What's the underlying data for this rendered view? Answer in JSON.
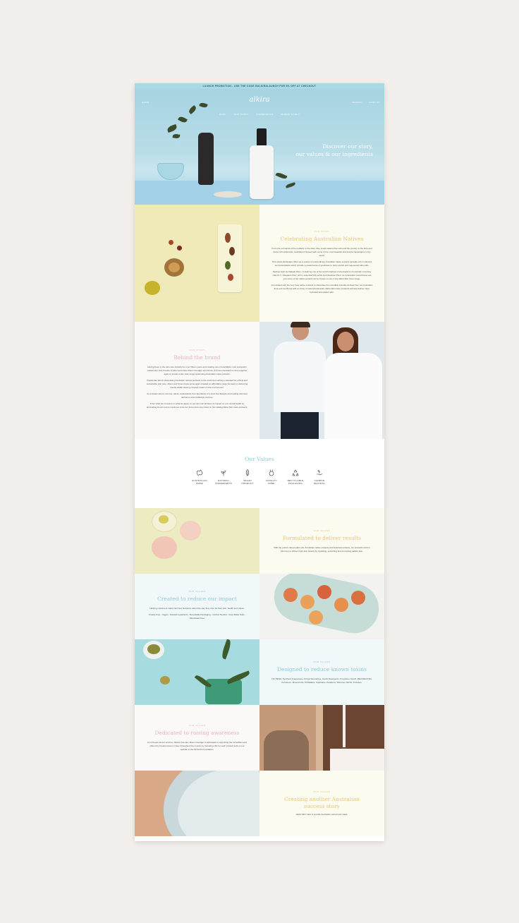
{
  "promo": "LAUNCH PROMOTION - USE THE CODE RALKIRALAUNCH FOR 5% OFF AT CHECKOUT",
  "nav": {
    "left": "HOME",
    "logo": "alkira",
    "right": [
      "SEARCH",
      "CART (0)"
    ],
    "menu": [
      "SHOP",
      "OUR STORY",
      "INGREDIENTS",
      "WHERE TO BUY"
    ]
  },
  "hero": {
    "title_line1": "Discover our story,",
    "title_line2": "our values & our ingredients"
  },
  "natives": {
    "eyebrow": "OUR STORY",
    "title": "Celebrating Australian Natives",
    "paragraphs": [
      "From the red sands of the outback to the clear, blue ocean waters that surround the country to the flora and fauna rich rainforests, Australia is blessed with some of the most beautiful and diverse landscapes in the world.",
      "This varied landscape offers up a variety of extraordinary Australian native extracts typically rich in vitamins and antioxidants which provide a powerhouse of goodness to help nourish and regenerate skin cells.",
      "Natives such as Kakadu Plum, containing one of the world's highest concentrations of naturally occurring vitamin C, Kangaroo Paw, rich in essential fatty acids and Davidson Plum, an antioxidant powerhouse are just some of the native extracts we've chosen to use in the Alkira Skin Care range.",
      "Formulated with the very best native extracts to showcase the incredible benefits derived from our Australian flora and combined with an array of natural botanicals, Alkira Skin Care products will help deliver clear, hydrated and radiant skin."
    ]
  },
  "brand": {
    "eyebrow": "OUR STORY",
    "title": "Behind the brand",
    "paragraphs": [
      "Having been in the skin care industry for over fifteen years and creating one of Australia's most successful natural skin care brands, brother and sister Alison Goodger and Simon O'Connor decided to come together again to create a skin care range celebrating Australian native extracts.",
      "Passionate about showcasing Australian natural products to the world and setting a standard for ethical and sustainable skin care, Alison and Simon have come again created an affordable range focused on delivering results whilst causing minimal impact on the environment.",
      "As a breast cancer survivor, Alison understands the importance of a toxic free lifestyle and making informed decisions around lifestyle choices.",
      "From what we consume to what we apply on our skin can all have an impact on our overall health so eliminating known toxins continues to be her focus and a key factor in formulating Alkira Skin Care products."
    ]
  },
  "values": {
    "title": "Our Values",
    "items": [
      {
        "l1": "AUSTRALIAN",
        "l2": "MADE"
      },
      {
        "l1": "NATURAL",
        "l2": "INGREDIENTS"
      },
      {
        "l1": "VEGAN",
        "l2": "PRODUCT"
      },
      {
        "l1": "CRUELTY",
        "l2": "FREE"
      },
      {
        "l1": "RECYCLABLE",
        "l2": "PACKAGING"
      },
      {
        "l1": "CARBON",
        "l2": "NEUTRAL"
      }
    ]
  },
  "results": {
    "eyebrow": "OUR VALUES",
    "title": "Formulated to deliver results",
    "body": "With the purest natural plant oils, Australian native extracts and botanical extracts, our products work in harmony to deliver triple skin beauty by hydrating, protecting and promoting radiant skin."
  },
  "impact": {
    "eyebrow": "OUR VALUES",
    "title": "Created to reduce our impact",
    "body1": "Helping customers make informed decisions about the way they care for their skin, health and planet.",
    "body2": "Cruelty Free - Vegan - Natural Ingredients - Recyclable Packaging - Carbon Neutral - Grey Water Safe - Microbead Free"
  },
  "toxins": {
    "eyebrow": "OUR VALUES",
    "title": "Designed to reduce known toxins",
    "body": "NO PEGS, Synthetic Fragrances, Animal Derivatives, Harsh Detergents, Propylene Glycol, MEA/DEA/TEA, Petroleum, Mineral Oils, Phthalates, Sulphates, Parabens, Silicones, EDTA, Triclosan."
  },
  "awareness": {
    "eyebrow": "OUR VALUES",
    "title": "Dedicated to raising awareness",
    "body": "As a breast cancer survivor, Alkira's founder, Alison Goodger is dedicated to supporting the incredible work offered by breast cancer nurses throughout the country by donating a $1 for each product sold on our website to the McGrath Foundation."
  },
  "success": {
    "eyebrow": "OUR VALUES",
    "title_line1": "Creating another Australian",
    "title_line2": "success story",
    "body": "Alkira Skin Care is proudly Australian owned and made."
  },
  "colors": {
    "gold": "#e8c27a",
    "pink": "#eab3b5",
    "blue": "#8cc8dc",
    "yellow_bg": "#efeab8",
    "cream_bg": "#fcfbef"
  }
}
